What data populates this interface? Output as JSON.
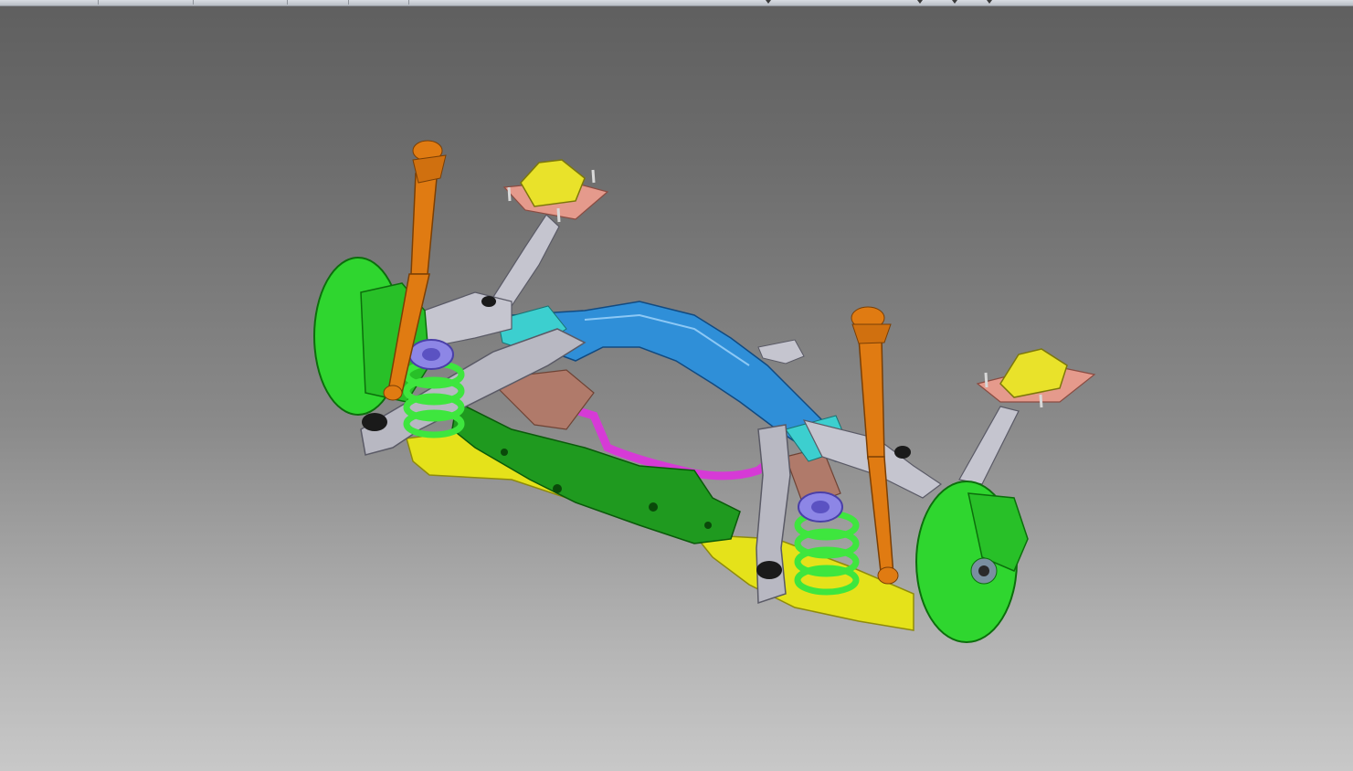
{
  "viewer": {
    "background_top": "#5f5f5f",
    "background_bottom": "#c8c8c8"
  },
  "model": {
    "parts": [
      {
        "name": "subframe-front-crossmember",
        "color": "#2f8fd8"
      },
      {
        "name": "subframe-rear-crossmember",
        "color": "#1f9a1f"
      },
      {
        "name": "lower-control-arm",
        "color": "#e5e21a"
      },
      {
        "name": "shock-absorber",
        "color": "#e07b12"
      },
      {
        "name": "coil-spring",
        "color": "#3ee63e"
      },
      {
        "name": "spring-seat",
        "color": "#8d86e6"
      },
      {
        "name": "brake-disc-hub",
        "color": "#2fd62f"
      },
      {
        "name": "upper-strut-mount",
        "color": "#e9e22a"
      },
      {
        "name": "mount-plate",
        "color": "#e59a8c"
      },
      {
        "name": "trailing-link",
        "color": "#b8b8c2"
      },
      {
        "name": "stabilizer-bar",
        "color": "#d63ad6"
      },
      {
        "name": "bracket",
        "color": "#3ccfcf"
      },
      {
        "name": "support-member",
        "color": "#b07a6a"
      }
    ]
  }
}
